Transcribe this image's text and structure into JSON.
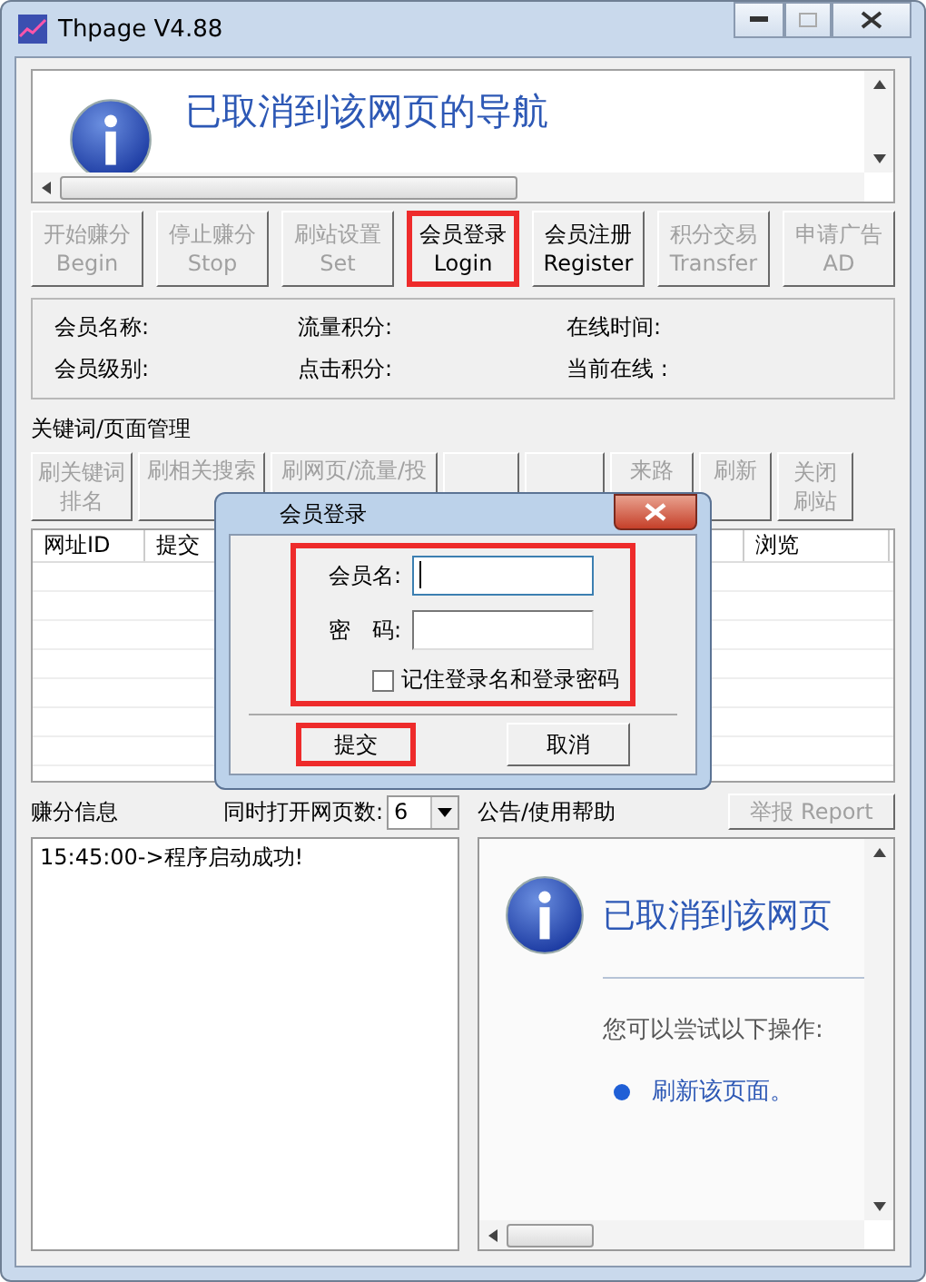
{
  "window": {
    "title": "Thpage V4.88"
  },
  "top_browser": {
    "message": "已取消到该网页的导航"
  },
  "main_buttons": [
    {
      "line1": "开始赚分",
      "line2": "Begin",
      "disabled": true,
      "highlighted": false
    },
    {
      "line1": "停止赚分",
      "line2": "Stop",
      "disabled": true,
      "highlighted": false
    },
    {
      "line1": "刷站设置",
      "line2": "Set",
      "disabled": true,
      "highlighted": false
    },
    {
      "line1": "会员登录",
      "line2": "Login",
      "disabled": false,
      "highlighted": true
    },
    {
      "line1": "会员注册",
      "line2": "Register",
      "disabled": false,
      "highlighted": false
    },
    {
      "line1": "积分交易",
      "line2": "Transfer",
      "disabled": true,
      "highlighted": false
    },
    {
      "line1": "申请广告",
      "line2": "AD",
      "disabled": true,
      "highlighted": false
    }
  ],
  "member_info": [
    "会员名称:",
    "流量积分:",
    "在线时间:",
    "会员级别:",
    "点击积分:",
    "当前在线 :"
  ],
  "keyword_section": {
    "title": "关键词/页面管理",
    "buttons": [
      {
        "kind": "text",
        "line1": "刷关键词",
        "line2": "排名"
      },
      {
        "kind": "text",
        "line1": "刷相关搜索"
      },
      {
        "kind": "text",
        "line1": "刷网页/流量/投"
      },
      {
        "kind": "blank"
      },
      {
        "kind": "blank"
      },
      {
        "kind": "text",
        "line1": "来路"
      },
      {
        "kind": "text",
        "line1": "刷新"
      },
      {
        "kind": "text",
        "line1": "关闭",
        "line2": "刷站"
      }
    ],
    "columns": [
      "网址ID",
      "提交",
      "浏览"
    ]
  },
  "earn_info": {
    "title": "赚分信息",
    "pages_label": "同时打开网页数:",
    "pages_value": "6",
    "log": [
      "15:45:00->程序启动成功!"
    ]
  },
  "help": {
    "title": "公告/使用帮助",
    "report_button": "举报 Report",
    "message": "已取消到该网页",
    "hint": "您可以尝试以下操作:",
    "link": "刷新该页面。"
  },
  "dialog": {
    "title": "会员登录",
    "fields": [
      {
        "label": "会员名:",
        "focused": true
      },
      {
        "label": "密　码:",
        "focused": false
      }
    ],
    "remember": {
      "label": "记住登录名和登录密码",
      "checked": false
    },
    "fields_highlighted": true,
    "buttons": [
      {
        "label": "提交",
        "highlighted": true
      },
      {
        "label": "取消",
        "highlighted": false
      }
    ]
  }
}
